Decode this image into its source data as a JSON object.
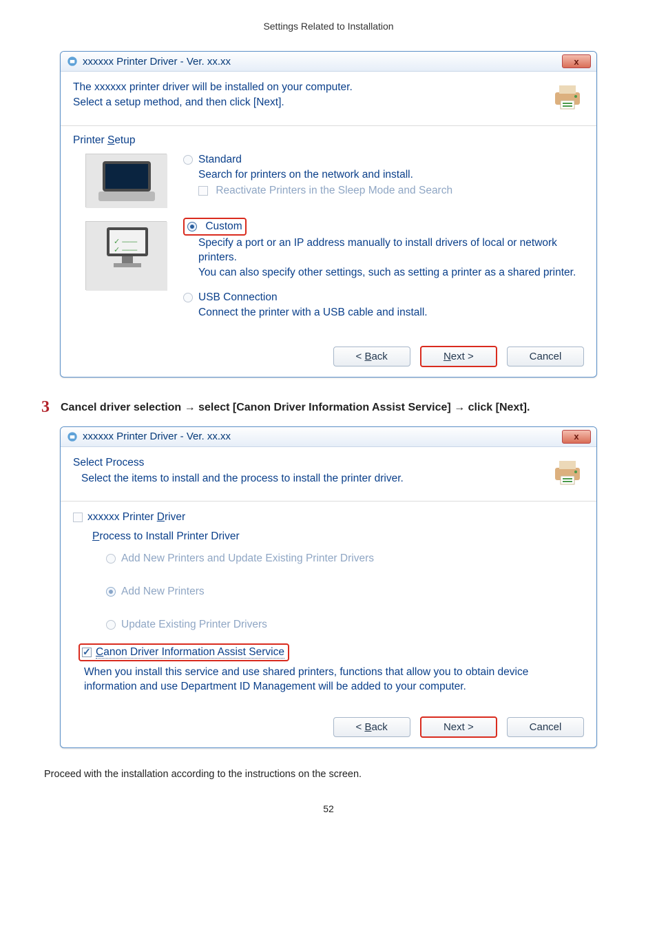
{
  "header": {
    "section": "Settings Related to Installation"
  },
  "dialog1": {
    "title": "xxxxxx Printer Driver - Ver. xx.xx",
    "close_label": "x",
    "intro_line1": "The xxxxxx printer driver will be installed on your computer.",
    "intro_line2": "Select a setup method, and then click [Next].",
    "group_label": "Printer Setup",
    "options": {
      "standard": {
        "label": "Standard",
        "desc": "Search for printers on the network and install.",
        "reactivate": "Reactivate Printers in the Sleep Mode and Search"
      },
      "custom": {
        "label": "Custom",
        "desc": "Specify a port or an IP address manually to install drivers of local or network printers.\nYou can also specify other settings, such as setting a printer as a shared printer."
      },
      "usb": {
        "label": "USB Connection",
        "desc": "Connect the printer with a USB cable and install."
      }
    },
    "buttons": {
      "back": "< Back",
      "next": "Next >",
      "cancel": "Cancel"
    }
  },
  "step3": {
    "num": "3",
    "text_pre": "Cancel driver selection → select [Canon Driver Information Assist Service] → click [Next]."
  },
  "dialog2": {
    "title": "xxxxxx Printer Driver - Ver. xx.xx",
    "close_label": "x",
    "head_title": "Select Process",
    "head_desc": "Select the items to install and the process to install the printer driver.",
    "driver_check": "xxxxxx Printer Driver",
    "process_label": "Process to Install Printer Driver",
    "proc_add_update": "Add New Printers and Update Existing Printer Drivers",
    "proc_add": "Add New Printers",
    "proc_update": "Update Existing Printer Drivers",
    "svc_label": "Canon Driver Information Assist Service",
    "svc_desc": "When you install this service and use shared printers, functions that allow you to obtain device information and use Department ID Management will be added to your computer.",
    "buttons": {
      "back": "< Back",
      "next": "Next >",
      "cancel": "Cancel"
    }
  },
  "footnote": "Proceed with the installation according to the instructions on the screen.",
  "pagenum": "52"
}
